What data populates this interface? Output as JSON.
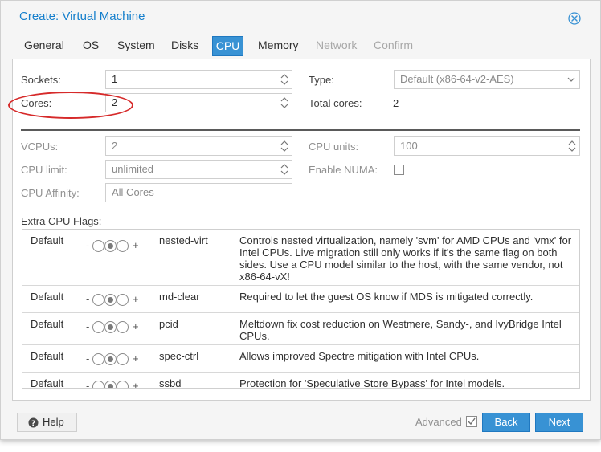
{
  "window": {
    "title": "Create: Virtual Machine"
  },
  "tabs": [
    {
      "label": "General",
      "state": "normal"
    },
    {
      "label": "OS",
      "state": "normal"
    },
    {
      "label": "System",
      "state": "normal"
    },
    {
      "label": "Disks",
      "state": "normal"
    },
    {
      "label": "CPU",
      "state": "active"
    },
    {
      "label": "Memory",
      "state": "normal"
    },
    {
      "label": "Network",
      "state": "disabled"
    },
    {
      "label": "Confirm",
      "state": "disabled"
    }
  ],
  "cpu": {
    "sockets_label": "Sockets:",
    "sockets_value": "1",
    "cores_label": "Cores:",
    "cores_value": "2",
    "type_label": "Type:",
    "type_value": "Default (x86-64-v2-AES)",
    "total_cores_label": "Total cores:",
    "total_cores_value": "2",
    "vcpus_label": "VCPUs:",
    "vcpus_value": "2",
    "cpu_units_label": "CPU units:",
    "cpu_units_value": "100",
    "cpu_limit_label": "CPU limit:",
    "cpu_limit_value": "unlimited",
    "enable_numa_label": "Enable NUMA:",
    "enable_numa_checked": false,
    "cpu_affinity_label": "CPU Affinity:",
    "cpu_affinity_placeholder": "All Cores",
    "extra_flags_label": "Extra CPU Flags:"
  },
  "flags": [
    {
      "state": "Default",
      "minus": "-",
      "plus": "+",
      "selected": 1,
      "name": "nested-virt",
      "description": "Controls nested virtualization, namely 'svm' for AMD CPUs and 'vmx' for Intel CPUs. Live migration still only works if it's the same flag on both sides. Use a CPU model similar to the host, with the same vendor, not x86-64-vX!"
    },
    {
      "state": "Default",
      "minus": "-",
      "plus": "+",
      "selected": 1,
      "name": "md-clear",
      "description": "Required to let the guest OS know if MDS is mitigated correctly."
    },
    {
      "state": "Default",
      "minus": "-",
      "plus": "+",
      "selected": 1,
      "name": "pcid",
      "description": "Meltdown fix cost reduction on Westmere, Sandy-, and IvyBridge Intel CPUs."
    },
    {
      "state": "Default",
      "minus": "-",
      "plus": "+",
      "selected": 1,
      "name": "spec-ctrl",
      "description": "Allows improved Spectre mitigation with Intel CPUs."
    },
    {
      "state": "Default",
      "minus": "-",
      "plus": "+",
      "selected": 1,
      "name": "ssbd",
      "description": "Protection for 'Speculative Store Bypass' for Intel models."
    }
  ],
  "footer": {
    "help_label": "Help",
    "advanced_label": "Advanced",
    "advanced_checked": true,
    "back_label": "Back",
    "next_label": "Next"
  },
  "colors": {
    "accent": "#3892d4",
    "title": "#157fcc",
    "highlight_oval": "#d62a2a"
  },
  "icons": [
    "close-icon",
    "spinner-icon",
    "dropdown-arrow-icon",
    "help-icon",
    "checkbox-icon"
  ]
}
